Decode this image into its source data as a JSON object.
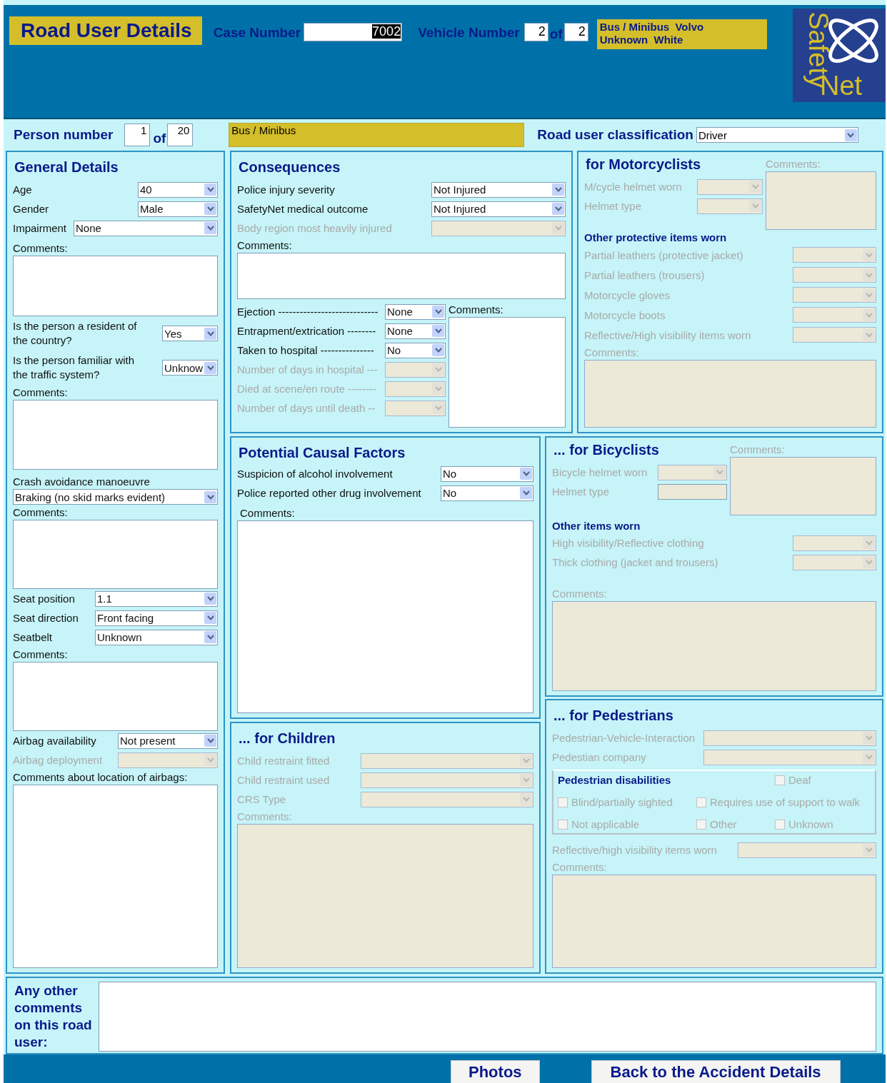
{
  "header": {
    "title": "Road User Details",
    "case_number_label": "Case Number",
    "case_number": {
      "value": "7002",
      "selected": true
    },
    "vehicle_label": "Vehicle Number",
    "vehicle_number": "2",
    "of": "of",
    "vehicle_total": "2",
    "vehicle_description": [
      "Bus / Minibus  Volvo",
      "Unknown  White"
    ],
    "logo": {
      "word1": "Safety",
      "word2": "Net"
    }
  },
  "person": {
    "label": "Person number",
    "number": "1",
    "of": "of",
    "total": "20",
    "vehicle_type": "Bus / Minibus",
    "classification_label": "Road user classification",
    "classification": "Driver"
  },
  "general_details": {
    "items": [
      {
        "kind": "title",
        "label": "General Details"
      },
      {
        "kind": "select",
        "label": "Age",
        "value": "40",
        "disabled": false
      },
      {
        "kind": "select",
        "label": "Gender",
        "value": "Male",
        "disabled": false
      },
      {
        "kind": "select",
        "label": "Impairment",
        "value": "None",
        "disabled": false
      },
      {
        "kind": "comments",
        "label": "Comments:",
        "disabled": false
      },
      {
        "kind": "select",
        "label": "Is the person a resident of the country?",
        "value": "Yes",
        "disabled": false
      },
      {
        "kind": "select",
        "label": "Is the person familiar with the traffic system?",
        "value": "Unknow",
        "disabled": false
      },
      {
        "kind": "comments",
        "label": "Comments:",
        "disabled": false
      },
      {
        "kind": "select_stacked",
        "label": "Crash avoidance manoeuvre",
        "value": "Braking (no skid marks evident)",
        "disabled": false
      },
      {
        "kind": "comments",
        "label": "Comments:",
        "disabled": false
      },
      {
        "kind": "select",
        "label": "Seat position",
        "value": "1.1",
        "disabled": false
      },
      {
        "kind": "select",
        "label": "Seat direction",
        "value": "Front facing",
        "disabled": false
      },
      {
        "kind": "select",
        "label": "Seatbelt",
        "value": "Unknown",
        "disabled": false
      },
      {
        "kind": "comments",
        "label": "Comments:",
        "disabled": false
      },
      {
        "kind": "select",
        "label": "Airbag availability",
        "value": "Not present",
        "disabled": false
      },
      {
        "kind": "select",
        "label": "Airbag deployment",
        "disabled": true
      },
      {
        "kind": "comments",
        "label": "Comments about location of airbags:",
        "disabled": false
      }
    ]
  },
  "consequences": {
    "items": [
      {
        "kind": "title",
        "label": "Consequences"
      },
      {
        "kind": "select",
        "label": "Police injury severity",
        "value": "Not Injured",
        "disabled": false
      },
      {
        "kind": "select",
        "label": "SafetyNet medical outcome",
        "value": "Not Injured",
        "disabled": false
      },
      {
        "kind": "select",
        "label": "Body region most heavily injured",
        "disabled": true
      },
      {
        "kind": "comments",
        "label": "Comments:",
        "disabled": false
      },
      {
        "kind": "split",
        "left": [
          {
            "kind": "select",
            "label": "Ejection ----------------------------",
            "value": "None",
            "disabled": false
          },
          {
            "kind": "select",
            "label": "Entrapment/extrication --------",
            "value": "None",
            "disabled": false
          },
          {
            "kind": "select",
            "label": "Taken to hospital ---------------",
            "value": "No",
            "disabled": false
          },
          {
            "kind": "select",
            "label": "Number of days in hospital ---",
            "disabled": true
          },
          {
            "kind": "select",
            "label": "Died at scene/en route --------",
            "disabled": true
          },
          {
            "kind": "select",
            "label": "Number of days until death --",
            "disabled": true
          }
        ],
        "right": [
          {
            "kind": "comments",
            "label": "Comments:",
            "disabled": false
          }
        ]
      }
    ]
  },
  "motorcyclists": {
    "items": [
      {
        "kind": "split",
        "left": [
          {
            "kind": "title",
            "label": "for Motorcyclists"
          },
          {
            "kind": "select",
            "label": "M/cycle helmet worn",
            "disabled": true
          },
          {
            "kind": "select",
            "label": "Helmet type",
            "disabled": true
          }
        ],
        "right": [
          {
            "kind": "comments",
            "label": "Comments:",
            "disabled": true
          }
        ]
      },
      {
        "kind": "subheading",
        "label": "Other protective items worn"
      },
      {
        "kind": "select",
        "label": "Partial leathers (protective jacket)",
        "disabled": true
      },
      {
        "kind": "select",
        "label": "Partial leathers (trousers)",
        "disabled": true
      },
      {
        "kind": "select",
        "label": "Motorcycle gloves",
        "disabled": true
      },
      {
        "kind": "select",
        "label": "Motorcycle boots",
        "disabled": true
      },
      {
        "kind": "select",
        "label": "Reflective/High visibility items worn",
        "disabled": true
      },
      {
        "kind": "comments",
        "label": "Comments:",
        "disabled": true
      }
    ]
  },
  "causal_factors": {
    "items": [
      {
        "kind": "title",
        "label": "Potential Causal Factors"
      },
      {
        "kind": "select",
        "label": "Suspicion of alcohol involvement",
        "value": "No",
        "disabled": false
      },
      {
        "kind": "select",
        "label": "Police reported other drug involvement",
        "value": "No",
        "disabled": false
      },
      {
        "kind": "comments",
        "label": "Comments:",
        "disabled": false
      }
    ]
  },
  "children": {
    "items": [
      {
        "kind": "title",
        "label": "... for Children"
      },
      {
        "kind": "select",
        "label": "Child restraint fitted",
        "disabled": true
      },
      {
        "kind": "select",
        "label": "Child restraint used",
        "disabled": true
      },
      {
        "kind": "select",
        "label": "CRS Type",
        "disabled": true
      },
      {
        "kind": "comments",
        "label": "Comments:",
        "disabled": true
      }
    ]
  },
  "bicyclists": {
    "items": [
      {
        "kind": "split",
        "left": [
          {
            "kind": "title",
            "label": "... for Bicyclists"
          },
          {
            "kind": "select",
            "label": "Bicycle helmet worn",
            "disabled": true
          },
          {
            "kind": "textfield",
            "label": "Helmet type",
            "disabled": true
          }
        ],
        "right": [
          {
            "kind": "comments",
            "label": "Comments:",
            "disabled": true
          }
        ]
      },
      {
        "kind": "subheading",
        "label": "Other items worn"
      },
      {
        "kind": "select",
        "label": "High visibility/Reflective clothing",
        "disabled": true
      },
      {
        "kind": "select",
        "label": "Thick clothing (jacket and trousers)",
        "disabled": true
      },
      {
        "kind": "comments",
        "label": "Comments:",
        "disabled": true
      }
    ]
  },
  "pedestrians": {
    "items": [
      {
        "kind": "title",
        "label": "... for Pedestrians"
      },
      {
        "kind": "select",
        "label": "Pedestrian-Vehicle-Interaction",
        "disabled": true
      },
      {
        "kind": "select",
        "label": "Pedestian company",
        "disabled": true
      },
      {
        "kind": "checkgroup",
        "label": "Pedestrian disabilities",
        "options": [
          {
            "label": "Deaf",
            "checked": false,
            "disabled": true
          },
          {
            "label": "Blind/partially sighted",
            "checked": false,
            "disabled": true
          },
          {
            "label": "Requires use of support to walk",
            "checked": false,
            "disabled": true
          },
          {
            "label": "Not applicable",
            "checked": false,
            "disabled": true
          },
          {
            "label": "Other",
            "checked": false,
            "disabled": true
          },
          {
            "label": "Unknown",
            "checked": false,
            "disabled": true
          }
        ]
      },
      {
        "kind": "select",
        "label": "Reflective/high visibility items worn",
        "disabled": true
      },
      {
        "kind": "comments",
        "label": "Comments:",
        "disabled": true
      }
    ]
  },
  "other_comments": {
    "label": "Any other comments on this road user:"
  },
  "buttons": [
    {
      "label": "Photos"
    },
    {
      "label": "Back to the Accident Details"
    }
  ]
}
